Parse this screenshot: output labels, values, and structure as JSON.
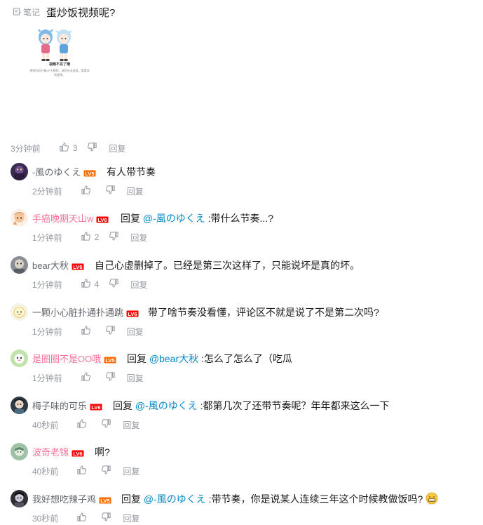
{
  "root": {
    "note_label": "笔记",
    "text": "蛋炒饭视频呢?",
    "image": {
      "title": "视频不见了哦",
      "desc": "视频内容已被UP主删除，请您先去逛逛，看看其他视频。"
    },
    "time": "3分钟前",
    "likes": "3",
    "reply_label": "回复"
  },
  "replies": [
    {
      "name": "-風のゆくえ",
      "level": "LV5",
      "name_color": "gray",
      "prefix": "",
      "at": "",
      "text": "有人带节奏",
      "time": "2分钟前",
      "likes": "",
      "reply_label": "回复"
    },
    {
      "name": "手癌晚期天山w",
      "level": "LV6",
      "name_color": "pink",
      "prefix": "回复 ",
      "at": "@-風のゆくえ",
      "text": " :带什么节奏...?",
      "time": "1分钟前",
      "likes": "2",
      "reply_label": "回复"
    },
    {
      "name": "bear大秋",
      "level": "LV6",
      "name_color": "gray",
      "prefix": "",
      "at": "",
      "text": "自己心虚删掉了。已经是第三次这样了，只能说坏是真的坏。",
      "time": "1分钟前",
      "likes": "4",
      "reply_label": "回复"
    },
    {
      "name": "一颗小心脏扑通扑通跳",
      "level": "LV6",
      "name_color": "gray",
      "prefix": "",
      "at": "",
      "text": "带了啥节奏没看懂，评论区不就是说了不是第二次吗?",
      "time": "1分钟前",
      "likes": "",
      "reply_label": "回复"
    },
    {
      "name": "是圈圈不是OO哦",
      "level": "LV5",
      "name_color": "pink",
      "prefix": "回复 ",
      "at": "@bear大秋",
      "text": " :怎么了怎么了（吃瓜",
      "time": "1分钟前",
      "likes": "",
      "reply_label": "回复"
    },
    {
      "name": "梅子味的可乐",
      "level": "LV6",
      "name_color": "gray",
      "prefix": "回复 ",
      "at": "@-風のゆくえ",
      "text": " :都第几次了还带节奏呢？年年都来这么一下",
      "time": "40秒前",
      "likes": "",
      "reply_label": "回复"
    },
    {
      "name": "波奇老锦",
      "level": "LV6",
      "name_color": "pink",
      "prefix": "",
      "at": "",
      "text": "啊?",
      "time": "40秒前",
      "likes": "",
      "reply_label": "回复"
    },
    {
      "name": "我好想吃辣子鸡",
      "level": "LV5",
      "name_color": "gray",
      "prefix": "回复 ",
      "at": "@-風のゆくえ",
      "text": " :带节奏，你是说某人连续三年这个时候教做饭吗?",
      "time": "30秒前",
      "likes": "",
      "reply_label": "回复"
    }
  ],
  "colors": {
    "text": "#18191c",
    "meta": "#9499a0",
    "username": "#61666d",
    "vip_pink": "#fb7299",
    "mention": "#008ac5",
    "lv5": "#ff6c00",
    "lv6": "#ff0000"
  }
}
